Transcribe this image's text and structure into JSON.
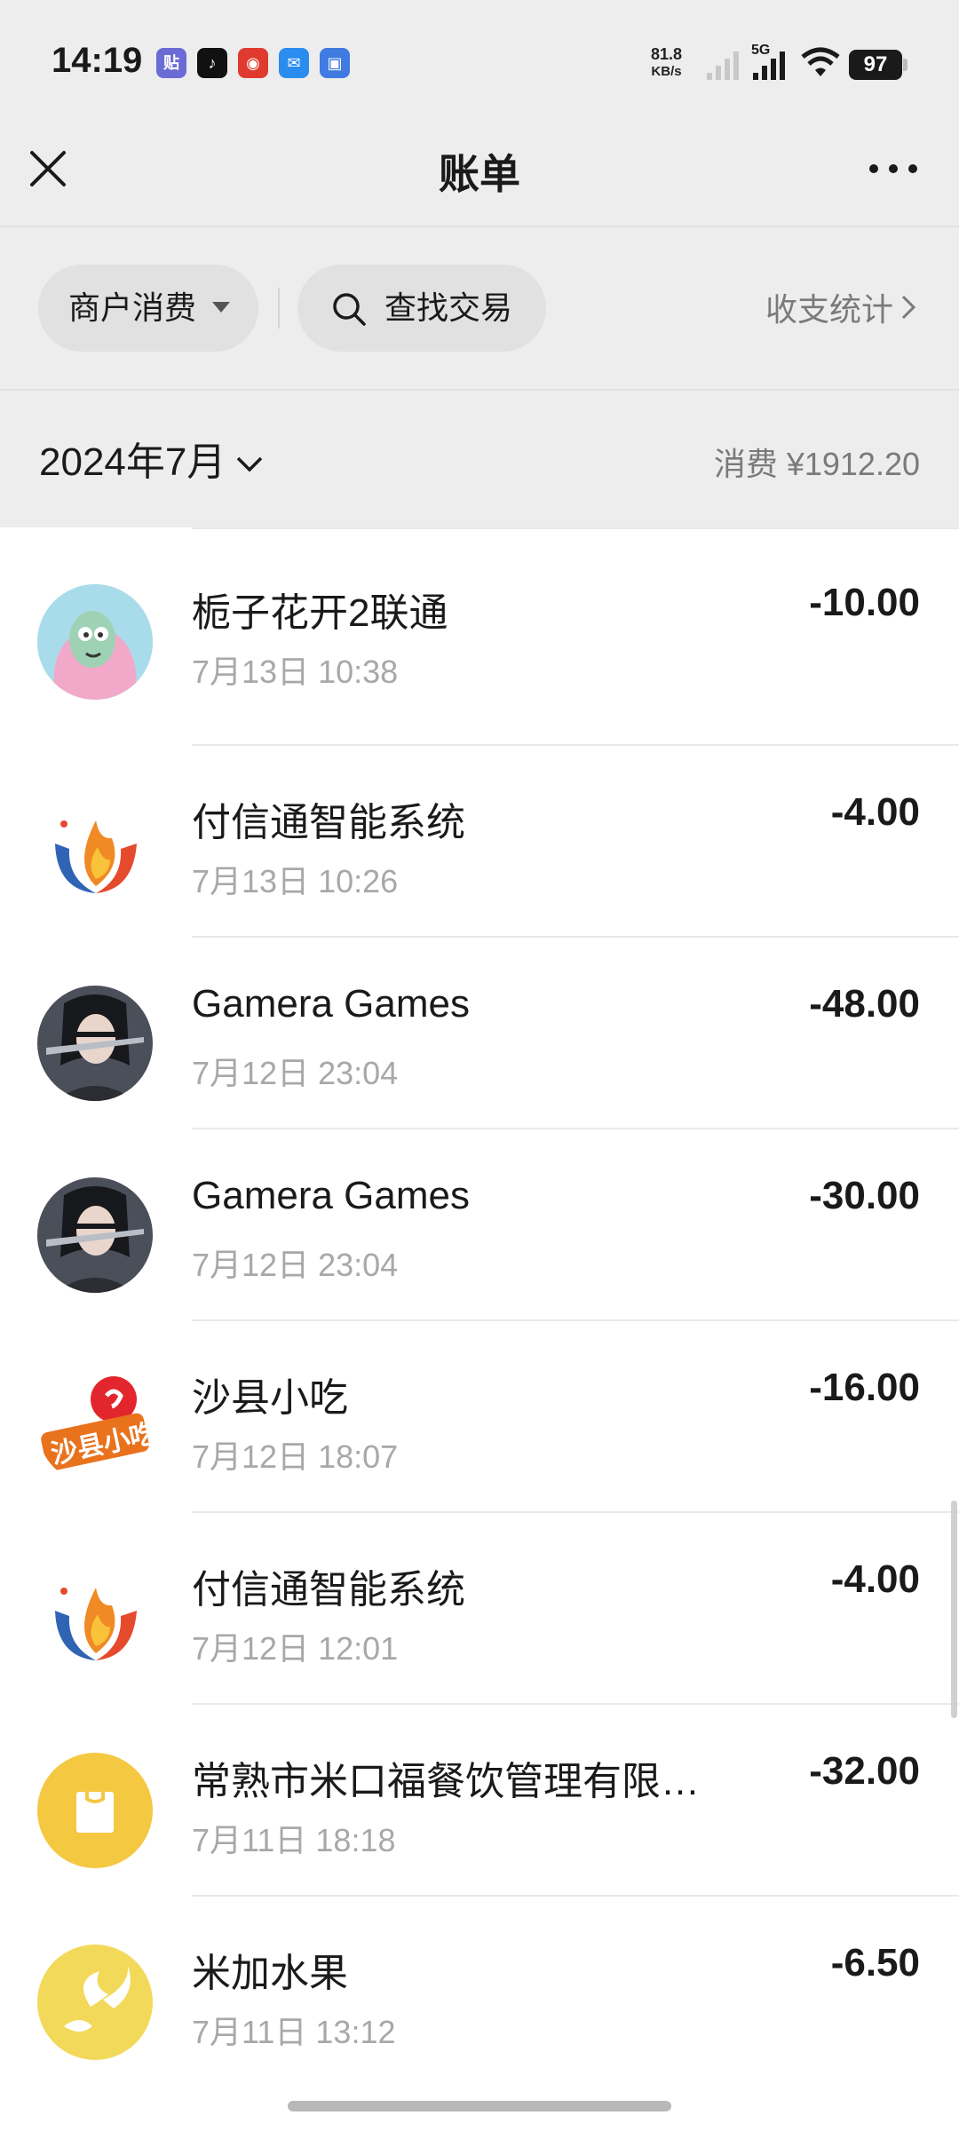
{
  "status_bar": {
    "time": "14:19",
    "network_speed_value": "81.8",
    "network_speed_unit": "KB/s",
    "network_type": "5G",
    "battery": "97",
    "notifications": [
      {
        "icon": "tieba-icon",
        "glyph": "贴",
        "color": "#6b6bd6"
      },
      {
        "icon": "tiktok-icon",
        "glyph": "♪",
        "color": "#111111"
      },
      {
        "icon": "xiaohongshu-icon",
        "glyph": "◉",
        "color": "#e03a2f"
      },
      {
        "icon": "mail-icon",
        "glyph": "✉",
        "color": "#2b8cf0"
      },
      {
        "icon": "app-icon",
        "glyph": "▣",
        "color": "#3f7be0"
      }
    ]
  },
  "nav": {
    "title": "账单",
    "close_icon": "close-icon",
    "more_icon": "more-icon"
  },
  "filters": {
    "category_label": "商户消费",
    "search_label": "查找交易",
    "stats_label": "收支统计"
  },
  "month": {
    "label": "2024年7月",
    "summary": "消费 ¥1912.20"
  },
  "transactions": [
    {
      "merchant": "栀子花开2联通",
      "date": "7月13日 10:38",
      "amount": "-10.00",
      "avatar": "cartoon-avatar"
    },
    {
      "merchant": "付信通智能系统",
      "date": "7月13日 10:26",
      "amount": "-4.00",
      "avatar": "flame-logo"
    },
    {
      "merchant": "Gamera Games",
      "date": "7月12日 23:04",
      "amount": "-48.00",
      "avatar": "game-character-avatar"
    },
    {
      "merchant": "Gamera Games",
      "date": "7月12日 23:04",
      "amount": "-30.00",
      "avatar": "game-character-avatar"
    },
    {
      "merchant": "沙县小吃",
      "date": "7月12日 18:07",
      "amount": "-16.00",
      "avatar": "shaxian-snacks-logo"
    },
    {
      "merchant": "付信通智能系统",
      "date": "7月12日 12:01",
      "amount": "-4.00",
      "avatar": "flame-logo"
    },
    {
      "merchant": "常熟市米口福餐饮管理有限…",
      "date": "7月11日 18:18",
      "amount": "-32.00",
      "avatar": "shopping-bag-icon"
    },
    {
      "merchant": "米加水果",
      "date": "7月11日 13:12",
      "amount": "-6.50",
      "avatar": "birds-logo"
    }
  ],
  "colors": {
    "header_bg": "#ededed",
    "pill_bg": "#e1e1e1",
    "secondary_text": "#a8a8a8",
    "bag_yellow": "#f5c842"
  }
}
